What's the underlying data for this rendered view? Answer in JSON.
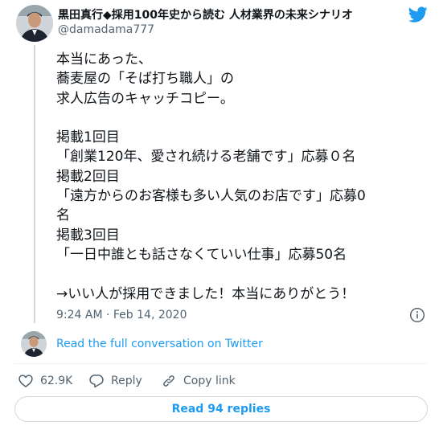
{
  "author": {
    "display_name": "黒田真行◆採用100年史から読む 人材業界の未来シナリオ",
    "username": "@damadama777"
  },
  "tweet": {
    "lines": [
      "本当にあった、",
      "蕎麦屋の「そば打ち職人」の",
      "求人広告のキャッチコピー。",
      "",
      "掲載1回目",
      "「創業120年、愛され続ける老舗です」応募０名",
      "掲載2回目",
      "「遠方からのお客様も多い人気のお店です」応募0",
      "名",
      "掲載3回目",
      "「一日中誰とも話さなくていい仕事」応募50名",
      "",
      "→いい人が採用できました！本当にありがとう！"
    ],
    "timestamp": "9:24 AM · Feb 14, 2020"
  },
  "conversation": {
    "link_text": "Read the full conversation on Twitter"
  },
  "actions": {
    "like_count": "62.9K",
    "reply_label": "Reply",
    "copy_link_label": "Copy link"
  },
  "replies_button": "Read 94 replies",
  "colors": {
    "brand": "#1d9bf0",
    "text": "#0f1419",
    "muted": "#536471",
    "border": "#cfd9de"
  },
  "icons": [
    "twitter-bird-icon",
    "info-icon",
    "heart-icon",
    "reply-icon",
    "link-icon"
  ]
}
